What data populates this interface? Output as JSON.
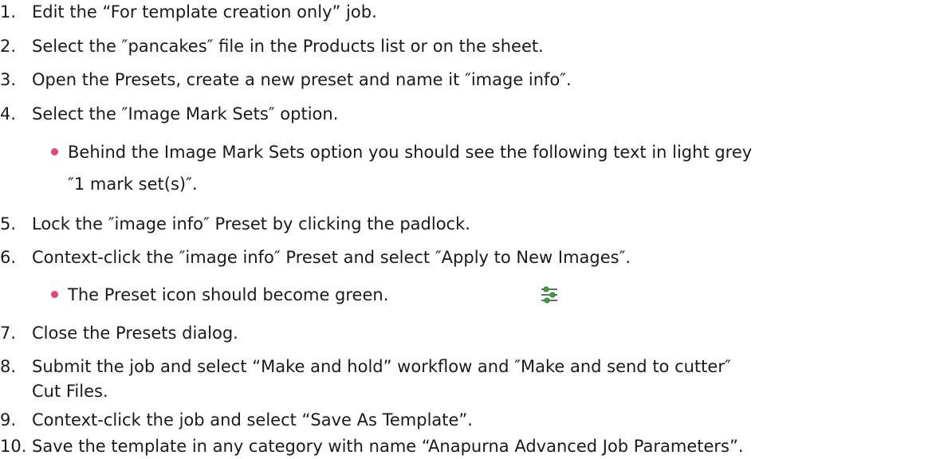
{
  "steps": [
    {
      "num": "1.",
      "text": "Edit the “For template creation only” job."
    },
    {
      "num": "2.",
      "text": "Select the ″pancakes″ file in the Products list or on the sheet."
    },
    {
      "num": "3.",
      "text": "Open the Presets, create a new preset and name it ″image info″."
    },
    {
      "num": "4.",
      "text": "Select the ″Image Mark Sets″ option."
    },
    {
      "num": "5.",
      "text": "Lock the ″image info″ Preset by clicking the padlock."
    },
    {
      "num": "6.",
      "text": "Context-click the ″image info″ Preset and select ″Apply to New Images″."
    },
    {
      "num": "7.",
      "text": "Close the Presets dialog."
    },
    {
      "num": "8.",
      "text": "Submit the job and select “Make and hold” workflow and ″Make and send to cutter″",
      "cont": "Cut Files."
    },
    {
      "num": "9.",
      "text": "Context-click the job and select “Save As Template”."
    },
    {
      "num": "10.",
      "text": "Save the template in any category with name “Anapurna Advanced Job Parameters”."
    }
  ],
  "bullets": {
    "step4": {
      "text": "Behind the Image Mark Sets option you should see the following text in light grey",
      "cont": "″1 mark set(s)″."
    },
    "step6": {
      "text": "The Preset icon should become green."
    }
  },
  "colors": {
    "bullet": "#e0457b",
    "icon_green": "#3aa63a",
    "icon_gray": "#6b6b6b"
  },
  "icons": {
    "preset": "preset-sliders-icon"
  }
}
